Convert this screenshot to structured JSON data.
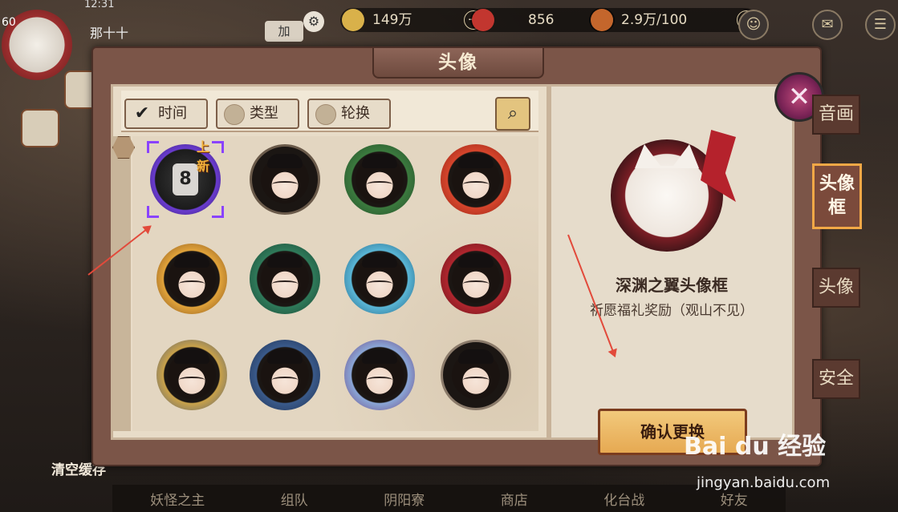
{
  "hud": {
    "time": "12:31",
    "level": "60",
    "player_name": "那十十",
    "add_label": "加",
    "coins": "149万",
    "jade": "856",
    "stamina": "2.9万/100"
  },
  "panel": {
    "title": "头像",
    "filters": [
      {
        "label": "时间",
        "checked": true
      },
      {
        "label": "类型",
        "checked": false
      },
      {
        "label": "轮换",
        "checked": false
      }
    ],
    "new_badge": "上新",
    "lock_glyph": "8"
  },
  "preview": {
    "name": "深渊之翼头像框",
    "desc": "祈愿福礼奖励（观山不见）",
    "confirm_label": "确认更换"
  },
  "side_tabs": [
    {
      "label": "音画",
      "active": false
    },
    {
      "label": "头像框",
      "active": true
    },
    {
      "label": "头像",
      "active": false
    },
    {
      "label": "安全",
      "active": false
    }
  ],
  "bottom_bar": {
    "clear_label": "清空缓存",
    "items": [
      "妖怪之主",
      "组队",
      "阴阳寮",
      "商店",
      "化台战",
      "好友"
    ]
  },
  "watermark": {
    "brand": "Bai du 经验",
    "url": "jingyan.baidu.com"
  },
  "colors": {
    "panel": "#7b5548",
    "accent": "#f2a846",
    "arrow": "#e24a3b"
  }
}
